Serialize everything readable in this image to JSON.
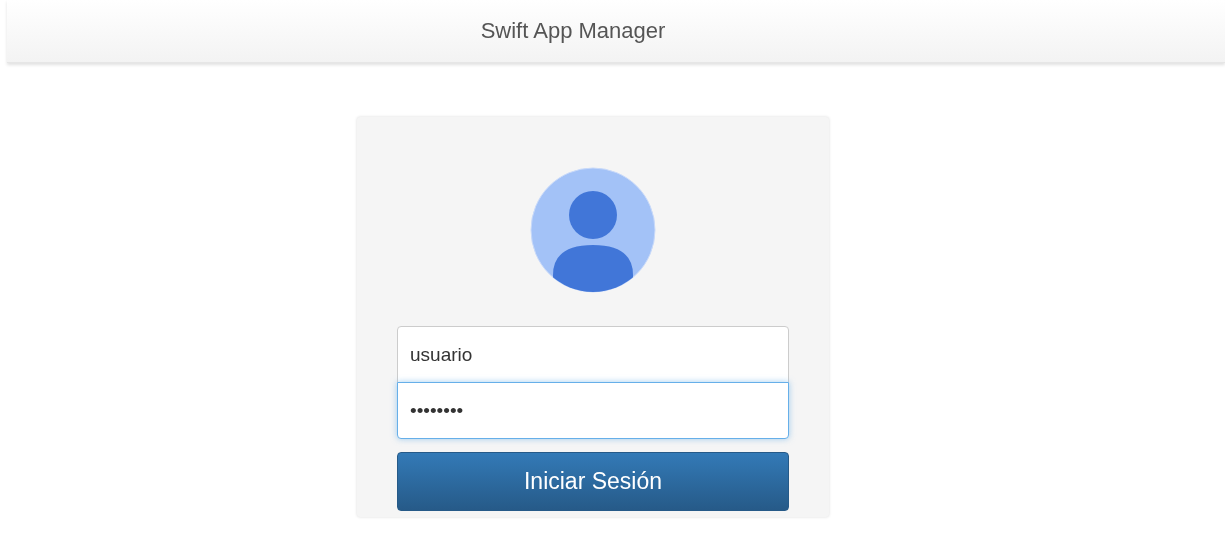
{
  "header": {
    "title": "Swift App Manager"
  },
  "login": {
    "username": {
      "value": "usuario",
      "focused": false
    },
    "password": {
      "value": "••••••••",
      "focused": true
    },
    "submit": "Iniciar Sesión"
  }
}
